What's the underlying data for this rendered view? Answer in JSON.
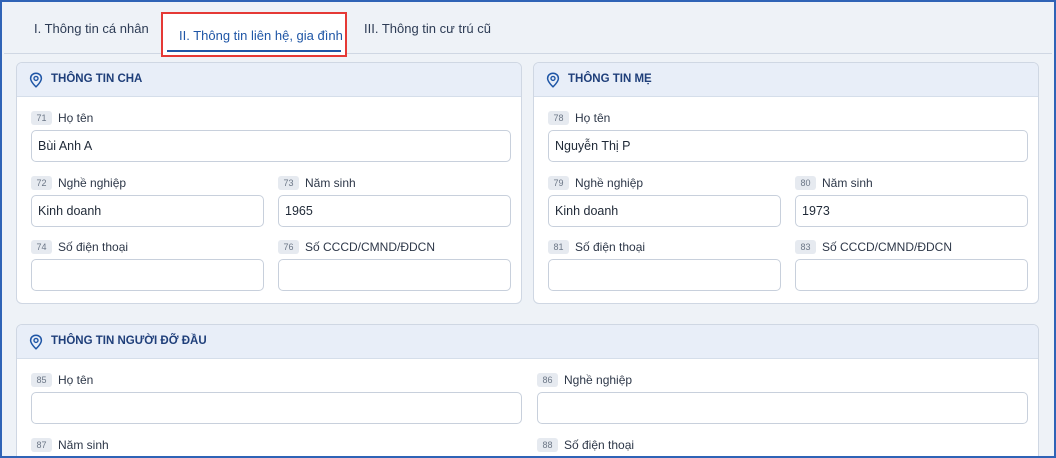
{
  "tabs": [
    {
      "label": "I. Thông tin cá nhân"
    },
    {
      "label": "II. Thông tin liên hệ, gia đình"
    },
    {
      "label": "III. Thông tin cư trú cũ"
    }
  ],
  "father": {
    "title": "THÔNG TIN CHA",
    "fields": [
      {
        "num": "71",
        "label": "Họ tên",
        "value": "Bùi Anh A"
      },
      {
        "num": "72",
        "label": "Nghề nghiệp",
        "value": "Kinh doanh"
      },
      {
        "num": "73",
        "label": "Năm sinh",
        "value": "1965"
      },
      {
        "num": "74",
        "label": "Số điện thoại",
        "value": ""
      },
      {
        "num": "76",
        "label": "Số CCCD/CMND/ĐDCN",
        "value": ""
      }
    ]
  },
  "mother": {
    "title": "THÔNG TIN MẸ",
    "fields": [
      {
        "num": "78",
        "label": "Họ tên",
        "value": "Nguyễn Thị P"
      },
      {
        "num": "79",
        "label": "Nghề nghiệp",
        "value": "Kinh doanh"
      },
      {
        "num": "80",
        "label": "Năm sinh",
        "value": "1973"
      },
      {
        "num": "81",
        "label": "Số điện thoại",
        "value": ""
      },
      {
        "num": "83",
        "label": "Số CCCD/CMND/ĐDCN",
        "value": ""
      }
    ]
  },
  "guardian": {
    "title": "THÔNG TIN NGƯỜI ĐỠ ĐẦU",
    "fields": [
      {
        "num": "85",
        "label": "Họ tên",
        "value": ""
      },
      {
        "num": "86",
        "label": "Nghề nghiệp",
        "value": ""
      },
      {
        "num": "87",
        "label": "Năm sinh",
        "value": ""
      },
      {
        "num": "88",
        "label": "Số điện thoại",
        "value": ""
      }
    ]
  },
  "colors": {
    "accent": "#1f56a6",
    "highlight": "#e53935",
    "header_bg": "#e8eef8"
  },
  "icons": {
    "section": "map-pin-icon"
  }
}
